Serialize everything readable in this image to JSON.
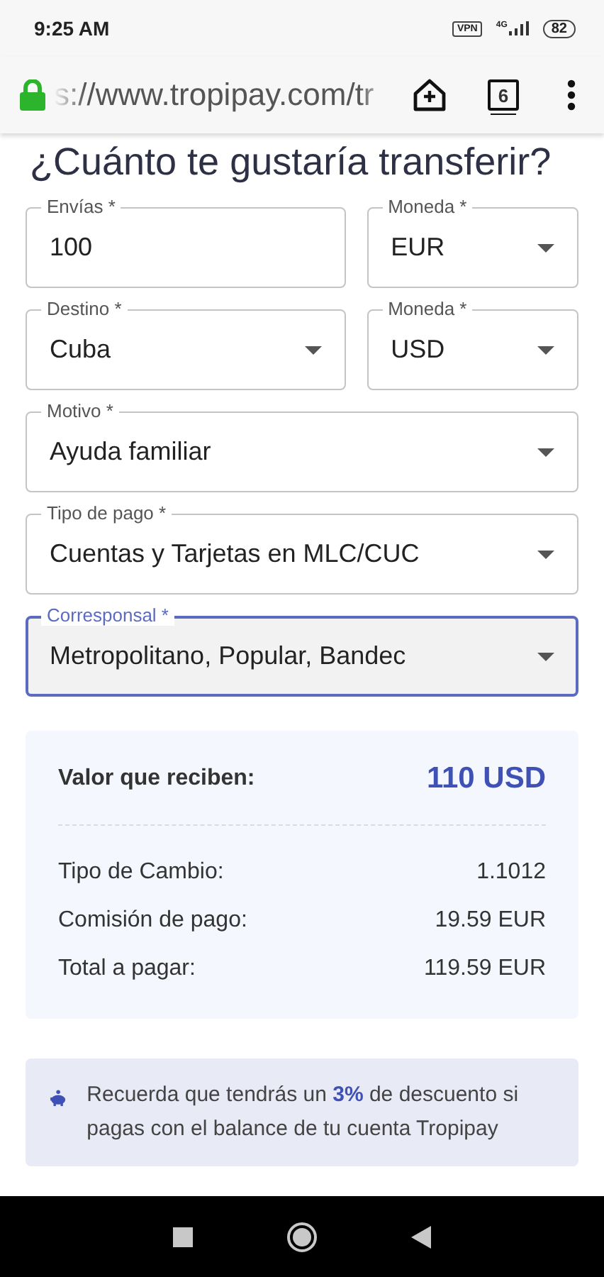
{
  "status_bar": {
    "time": "9:25 AM",
    "vpn": "VPN",
    "network": "4G",
    "battery": "82"
  },
  "browser": {
    "url": "s://www.tropipay.com/tr",
    "tab_count": "6"
  },
  "title": "¿Cuánto te gustaría transferir?",
  "form_rows": [
    [
      {
        "label": "Envías *",
        "value": "100",
        "kind": "text",
        "focused": false
      },
      {
        "label": "Moneda *",
        "value": "EUR",
        "kind": "select",
        "focused": false
      }
    ],
    [
      {
        "label": "Destino *",
        "value": "Cuba",
        "kind": "select",
        "focused": false
      },
      {
        "label": "Moneda *",
        "value": "USD",
        "kind": "select",
        "focused": false
      }
    ],
    [
      {
        "label": "Motivo *",
        "value": "Ayuda familiar",
        "kind": "select",
        "focused": false
      }
    ],
    [
      {
        "label": "Tipo de pago *",
        "value": "Cuentas y Tarjetas en MLC/CUC",
        "kind": "select",
        "focused": false
      }
    ],
    [
      {
        "label": "Corresponsal *",
        "value": "Metropolitano, Popular, Bandec",
        "kind": "select",
        "focused": true
      }
    ]
  ],
  "summary": {
    "headline": {
      "label": "Valor que reciben:",
      "value": "110 USD"
    },
    "rows": [
      {
        "label": "Tipo de Cambio:",
        "value": "1.1012"
      },
      {
        "label": "Comisión de pago:",
        "value": "19.59 EUR"
      },
      {
        "label": "Total a pagar:",
        "value": "119.59 EUR"
      }
    ]
  },
  "notice": "Recuerda que tendrás un **3%** de descuento si pagas con el balance de tu cuenta Tropipay"
}
